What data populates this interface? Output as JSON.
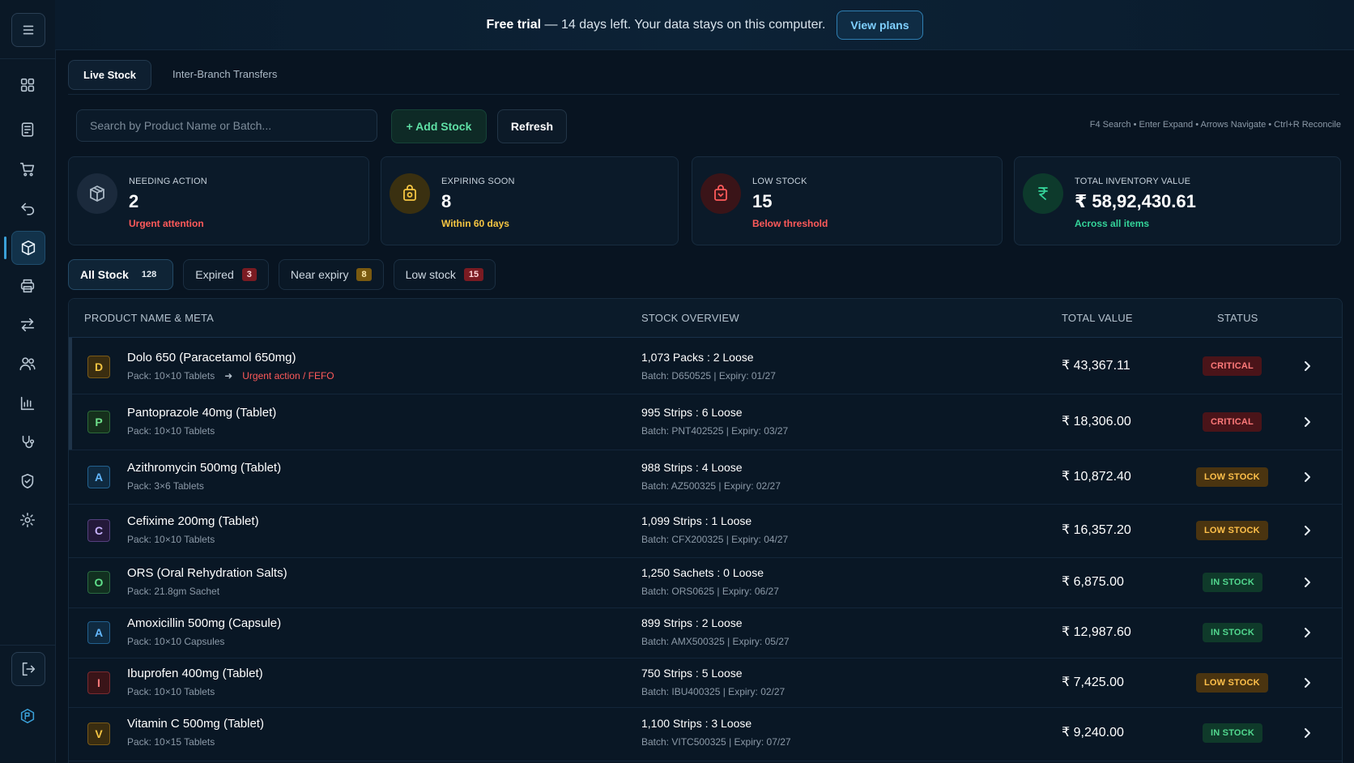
{
  "banner": {
    "bold": "Free trial",
    "text": "— 14 days left. Your data stays on this computer.",
    "button": "View plans"
  },
  "sidebar": {
    "items": [
      {
        "name": "dashboard",
        "icon": "grid-icon"
      },
      {
        "name": "billing",
        "icon": "document-icon"
      },
      {
        "name": "purchase",
        "icon": "cart-icon"
      },
      {
        "name": "returns",
        "icon": "undo-icon"
      },
      {
        "name": "inventory",
        "icon": "box-icon",
        "active": true
      },
      {
        "name": "print",
        "icon": "printer-icon"
      },
      {
        "name": "transfers",
        "icon": "swap-icon"
      },
      {
        "name": "customers",
        "icon": "users-icon"
      },
      {
        "name": "reports",
        "icon": "bar-chart-icon"
      },
      {
        "name": "doctors",
        "icon": "stethoscope-icon"
      },
      {
        "name": "compliance",
        "icon": "shield-icon"
      },
      {
        "name": "settings",
        "icon": "gear-icon"
      }
    ]
  },
  "tabs": [
    "Live Stock",
    "Inter-Branch Transfers"
  ],
  "toolbar": {
    "search_placeholder": "Search by Product Name or Batch...",
    "add_label": "+ Add Stock",
    "refresh_label": "Refresh",
    "shortcuts": "F4 Search • Enter Expand • Arrows Navigate • Ctrl+R Reconcile"
  },
  "cards": [
    {
      "label": "NEEDING ACTION",
      "value": "2",
      "sub": "Urgent attention",
      "color": "#ff5a5a"
    },
    {
      "label": "EXPIRING SOON",
      "value": "8",
      "sub": "Within 60 days",
      "color": "#f5c542"
    },
    {
      "label": "LOW STOCK",
      "value": "15",
      "sub": "Below threshold",
      "color": "#ff5a5a"
    },
    {
      "label": "TOTAL INVENTORY VALUE",
      "value": "₹ 58,92,430.61",
      "sub": "Across all items",
      "color": "#34d399"
    }
  ],
  "filters": [
    {
      "label": "All Stock",
      "count": "128"
    },
    {
      "label": "Expired",
      "count": "3"
    },
    {
      "label": "Near expiry",
      "count": "8"
    },
    {
      "label": "Low stock",
      "count": "15"
    }
  ],
  "table": {
    "headers": [
      "PRODUCT NAME & META",
      "STOCK OVERVIEW",
      "TOTAL VALUE",
      "STATUS"
    ],
    "rows": [
      {
        "letter": "D",
        "name": "Dolo 650 (Paracetamol 650mg)",
        "pack": "Pack: 10×10 Tablets",
        "flag": "Urgent action / FEFO",
        "stock": "1,073 Packs : 2 Loose",
        "batch": "Batch: D650525  |  Expiry: 01/27",
        "total": "₹ 43,367.11",
        "status": "CRITICAL"
      },
      {
        "letter": "P",
        "name": "Pantoprazole 40mg (Tablet)",
        "pack": "Pack: 10×10 Tablets",
        "stock": "995 Strips : 6 Loose",
        "batch": "Batch: PNT402525  |  Expiry: 03/27",
        "total": "₹ 18,306.00",
        "status": "CRITICAL"
      },
      {
        "letter": "A",
        "name": "Azithromycin 500mg (Tablet)",
        "pack": "Pack: 3×6 Tablets",
        "stock": "988 Strips : 4 Loose",
        "batch": "Batch: AZ500325  |  Expiry: 02/27",
        "total": "₹ 10,872.40",
        "status": "LOW STOCK"
      },
      {
        "letter": "C",
        "name": "Cefixime 200mg (Tablet)",
        "pack": "Pack: 10×10 Tablets",
        "stock": "1,099 Strips : 1 Loose",
        "batch": "Batch: CFX200325  |  Expiry: 04/27",
        "total": "₹ 16,357.20",
        "status": "LOW STOCK"
      },
      {
        "letter": "O",
        "name": "ORS (Oral Rehydration Salts)",
        "pack": "Pack: 21.8gm Sachet",
        "stock": "1,250 Sachets : 0 Loose",
        "batch": "Batch: ORS0625  |  Expiry: 06/27",
        "total": "₹ 6,875.00",
        "status": "IN STOCK"
      },
      {
        "letter": "A",
        "name": "Amoxicillin 500mg (Capsule)",
        "pack": "Pack: 10×10 Capsules",
        "stock": "899 Strips : 2 Loose",
        "batch": "Batch: AMX500325  |  Expiry: 05/27",
        "total": "₹ 12,987.60",
        "status": "IN STOCK"
      },
      {
        "letter": "I",
        "name": "Ibuprofen 400mg (Tablet)",
        "pack": "Pack: 10×10 Tablets",
        "stock": "750 Strips : 5 Loose",
        "batch": "Batch: IBU400325  |  Expiry: 02/27",
        "total": "₹ 7,425.00",
        "status": "LOW STOCK"
      },
      {
        "letter": "V",
        "name": "Vitamin C 500mg (Tablet)",
        "pack": "Pack: 10×15 Tablets",
        "stock": "1,100 Strips : 3 Loose",
        "batch": "Batch: VITC500325  |  Expiry: 07/27",
        "total": "₹ 9,240.00",
        "status": "IN STOCK"
      }
    ]
  },
  "colors": {
    "critical": "#ff7a7a",
    "low_stock": "#ffc04a",
    "in_stock": "#52d98f",
    "accent": "#3aa0d8"
  }
}
